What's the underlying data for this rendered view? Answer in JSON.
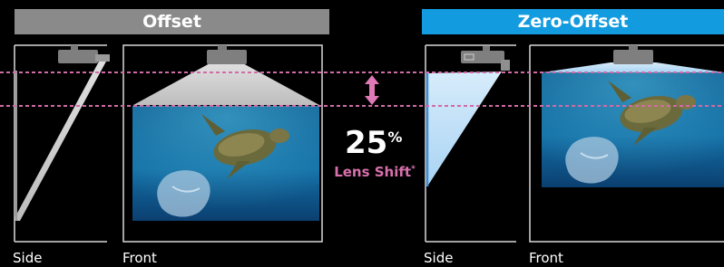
{
  "offset": {
    "title": "Offset",
    "side_label": "Side",
    "front_label": "Front"
  },
  "zero_offset": {
    "title": "Zero-Offset",
    "side_label": "Side",
    "front_label": "Front"
  },
  "lens_shift": {
    "value": "25",
    "unit": "%",
    "label": "Lens Shift",
    "footnote_mark": "*"
  },
  "colors": {
    "offset_banner": "#8a8a8a",
    "zero_offset_banner": "#139bdf",
    "guide_line": "#d06ba5",
    "lens_shift_text": "#d770ac"
  }
}
